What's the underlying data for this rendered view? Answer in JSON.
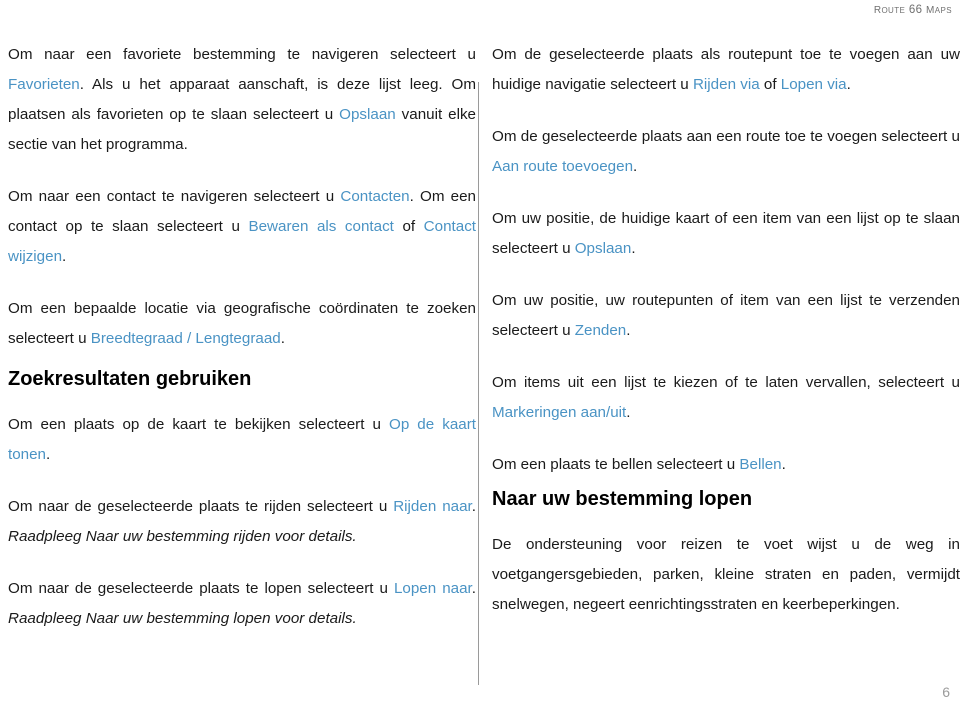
{
  "header": {
    "title": "ROUTE 66 MAPS",
    "title_main": "R",
    "title_rest": "OUTE 66 ",
    "title_m": "M",
    "title_aps": "APS"
  },
  "footer": {
    "page_number": "6"
  },
  "colors": {
    "link": "#4a93c4",
    "text": "#1a1a1a",
    "header_text": "#707070",
    "divider": "#9a9a9a",
    "page_number": "#9b9b9b"
  },
  "left_column": {
    "paragraphs": [
      {
        "id": "favorieten",
        "runs": [
          {
            "text": "Om naar een favoriete bestemming te navigeren selecteert u ",
            "style": "normal"
          },
          {
            "text": "Favorieten",
            "style": "link"
          },
          {
            "text": ". Als u het apparaat aanschaft, is deze lijst leeg. Om plaatsen als favorieten op te slaan selecteert u ",
            "style": "normal"
          },
          {
            "text": "Opslaan",
            "style": "link"
          },
          {
            "text": " vanuit elke sectie van het programma.",
            "style": "normal"
          }
        ]
      },
      {
        "id": "contacten",
        "runs": [
          {
            "text": "Om naar een contact te navigeren selecteert u ",
            "style": "normal"
          },
          {
            "text": "Contacten",
            "style": "link"
          },
          {
            "text": ". Om een contact op te slaan selecteert u ",
            "style": "normal"
          },
          {
            "text": "Bewaren als contact",
            "style": "link"
          },
          {
            "text": " of ",
            "style": "normal"
          },
          {
            "text": "Contact wijzigen",
            "style": "link"
          },
          {
            "text": ".",
            "style": "normal"
          }
        ]
      },
      {
        "id": "coordinaten",
        "runs": [
          {
            "text": "Om een bepaalde locatie via geografische coördinaten te zoeken selecteert u ",
            "style": "normal"
          },
          {
            "text": "Breedtegraad / Lengtegraad",
            "style": "link"
          },
          {
            "text": ".",
            "style": "normal"
          }
        ]
      }
    ],
    "heading": "Zoekresultaten gebruiken",
    "paragraphs_after_heading": [
      {
        "id": "op-de-kaart-tonen",
        "runs": [
          {
            "text": "Om een plaats op de kaart te bekijken selecteert u ",
            "style": "normal"
          },
          {
            "text": "Op de kaart tonen",
            "style": "link"
          },
          {
            "text": ".",
            "style": "normal"
          }
        ]
      },
      {
        "id": "rijden-naar",
        "runs": [
          {
            "text": "Om naar de geselecteerde plaats te rijden selecteert u ",
            "style": "normal"
          },
          {
            "text": "Rijden naar",
            "style": "link"
          },
          {
            "text": ". ",
            "style": "normal"
          },
          {
            "text": "Raadpleeg Naar uw bestemming rijden voor details.",
            "style": "italic"
          }
        ]
      },
      {
        "id": "lopen-naar",
        "runs": [
          {
            "text": "Om naar de geselecteerde plaats te lopen selecteert u ",
            "style": "normal"
          },
          {
            "text": "Lopen naar",
            "style": "link"
          },
          {
            "text": ". ",
            "style": "normal"
          },
          {
            "text": "Raadpleeg Naar uw bestemming lopen voor details.",
            "style": "italic"
          }
        ]
      }
    ]
  },
  "right_column": {
    "paragraphs": [
      {
        "id": "routepunt",
        "runs": [
          {
            "text": "Om de geselecteerde plaats als routepunt toe te voegen aan uw huidige navigatie selecteert u ",
            "style": "normal"
          },
          {
            "text": "Rijden via",
            "style": "link"
          },
          {
            "text": " of ",
            "style": "normal"
          },
          {
            "text": "Lopen via",
            "style": "link"
          },
          {
            "text": ".",
            "style": "normal"
          }
        ]
      },
      {
        "id": "aan-route-toevoegen",
        "runs": [
          {
            "text": "Om de geselecteerde plaats aan een route toe te voegen selecteert u ",
            "style": "normal"
          },
          {
            "text": "Aan route toevoegen",
            "style": "link"
          },
          {
            "text": ".",
            "style": "normal"
          }
        ]
      },
      {
        "id": "opslaan",
        "runs": [
          {
            "text": "Om uw positie, de huidige kaart of een item van een lijst op te slaan selecteert u ",
            "style": "normal"
          },
          {
            "text": "Opslaan",
            "style": "link"
          },
          {
            "text": ".",
            "style": "normal"
          }
        ]
      },
      {
        "id": "zenden",
        "runs": [
          {
            "text": "Om uw positie, uw routepunten of item van een lijst te verzenden selecteert u ",
            "style": "normal"
          },
          {
            "text": "Zenden",
            "style": "link"
          },
          {
            "text": ".",
            "style": "normal"
          }
        ]
      },
      {
        "id": "markeringen",
        "runs": [
          {
            "text": "Om items uit een lijst te kiezen of te laten vervallen, selecteert u ",
            "style": "normal"
          },
          {
            "text": "Markeringen aan/uit",
            "style": "link"
          },
          {
            "text": ".",
            "style": "normal"
          }
        ]
      },
      {
        "id": "bellen",
        "runs": [
          {
            "text": "Om een plaats te bellen selecteert u ",
            "style": "normal"
          },
          {
            "text": "Bellen",
            "style": "link"
          },
          {
            "text": ".",
            "style": "normal"
          }
        ]
      }
    ],
    "heading": "Naar uw bestemming lopen",
    "paragraphs_after_heading": [
      {
        "id": "lopen-beschrijving",
        "runs": [
          {
            "text": "De ondersteuning voor reizen te voet wijst u de weg in voetgangersgebieden, parken, kleine straten en paden, vermijdt snelwegen, negeert eenrichtingsstraten en keerbeperkingen.",
            "style": "normal"
          }
        ]
      }
    ]
  }
}
